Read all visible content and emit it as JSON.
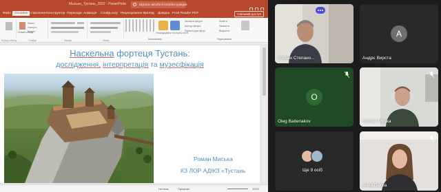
{
  "app": {
    "window_title": "Мыська_Тустань_2022 - PowerPoint",
    "search_placeholder": "Шукати засоби й потрібні довідки",
    "menu": [
      "Файл",
      "Основне",
      "Вставлення",
      "Конструктор",
      "Переходи",
      "Анімація",
      "Слайд-шоу",
      "Рецензування",
      "Вигляд",
      "Довідка",
      "Foxit Reader PDF"
    ],
    "share_label": "Спільний доступ"
  },
  "ribbon": {
    "clipboard_label": "Буфер обміну",
    "slides_label": "Слайди",
    "font_label": "Шрифт",
    "paragraph_label": "Абзац",
    "drawing_label": "Малювання",
    "editing_label": "Редагування",
    "arrange_label": "Упорядкувати",
    "quick_styles_label": "Експрес-стилі",
    "find_label": "Знайти",
    "replace_label": "Замінити",
    "select_label": "Виділити",
    "shape_fill": "Заливка фігури",
    "shape_outline": "Контур фігури",
    "shape_effects": "Ефекти для фігур",
    "new_slide": "Новий слайд",
    "layout": "Макет",
    "reset": "Скинути",
    "section": "Розділ"
  },
  "slide": {
    "title_part1": "Наскельна",
    "title_part2": "фортеця Тустань:",
    "subtitle_part1": "дослідження,",
    "subtitle_part2": "інтерпретація",
    "subtitle_part3": "та",
    "subtitle_part4": "музеєфікація",
    "author": "Роман Миська",
    "org": "КЗ ЛОР АДІКЗ «Тустань"
  },
  "status": {
    "notes": "Нотатки",
    "comments": "Примітки",
    "zoom": "110%"
  },
  "participants": [
    {
      "name": "Богдан Степано...",
      "has_video": true,
      "muted": false
    },
    {
      "name": "Андрє Вирста",
      "has_video": false,
      "initial": "A",
      "muted": false
    },
    {
      "name": "Oleg Baiteriakov",
      "has_video": false,
      "initial": "O",
      "muted": true
    },
    {
      "name": "Roman Myska",
      "has_video": true,
      "muted": true
    },
    {
      "name": "Ще 9 осіб",
      "has_video": false,
      "muted": false
    },
    {
      "name": "Анна Патра",
      "has_video": true,
      "muted": true
    }
  ],
  "colors": {
    "ppt_accent": "#b7472a",
    "slide_text": "#4f8fc0",
    "underline_red": "#e05a4a",
    "tile_dark": "#292929",
    "tile_green": "#1f4a24",
    "teams_purple": "#4c4cd6"
  }
}
